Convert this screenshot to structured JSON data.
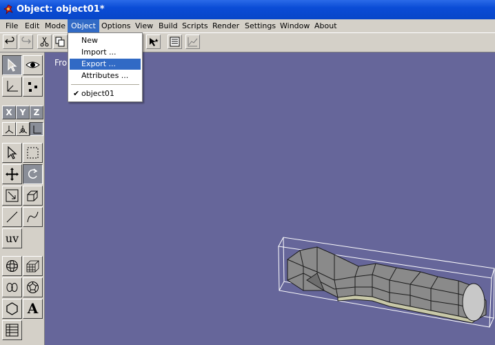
{
  "window": {
    "title": "Object: object01*"
  },
  "menubar": {
    "items": [
      {
        "id": "file",
        "label": "File"
      },
      {
        "id": "edit",
        "label": "Edit"
      },
      {
        "id": "mode",
        "label": "Mode"
      },
      {
        "id": "object",
        "label": "Object"
      },
      {
        "id": "options",
        "label": "Options"
      },
      {
        "id": "view",
        "label": "View"
      },
      {
        "id": "build",
        "label": "Build"
      },
      {
        "id": "scripts",
        "label": "Scripts"
      },
      {
        "id": "render",
        "label": "Render"
      },
      {
        "id": "settings",
        "label": "Settings"
      },
      {
        "id": "window",
        "label": "Window"
      },
      {
        "id": "about",
        "label": "About"
      }
    ],
    "open": "object"
  },
  "object_menu": {
    "items": [
      {
        "label": "New",
        "highlighted": false
      },
      {
        "label": "Import ...",
        "highlighted": false
      },
      {
        "label": "Export ...",
        "highlighted": true
      },
      {
        "label": "Attributes ...",
        "highlighted": false
      }
    ],
    "objects": [
      {
        "label": "object01",
        "checked": true
      }
    ]
  },
  "toolbar": {
    "icons": [
      "undo-icon",
      "redo-icon",
      "cut-icon",
      "copy-icon",
      "select-vertex-icon",
      "list-icon",
      "graph-icon"
    ]
  },
  "sidebar": {
    "axes": [
      "X",
      "Y",
      "Z"
    ],
    "uv_label": "UV",
    "text_tool_label": "A"
  },
  "viewport": {
    "label": "Front"
  },
  "colors": {
    "viewport_bg": "#66669a",
    "menu_highlight": "#316ac5",
    "titlebar": "#0a4cd6",
    "mesh_fill": "#8a8a8a"
  }
}
